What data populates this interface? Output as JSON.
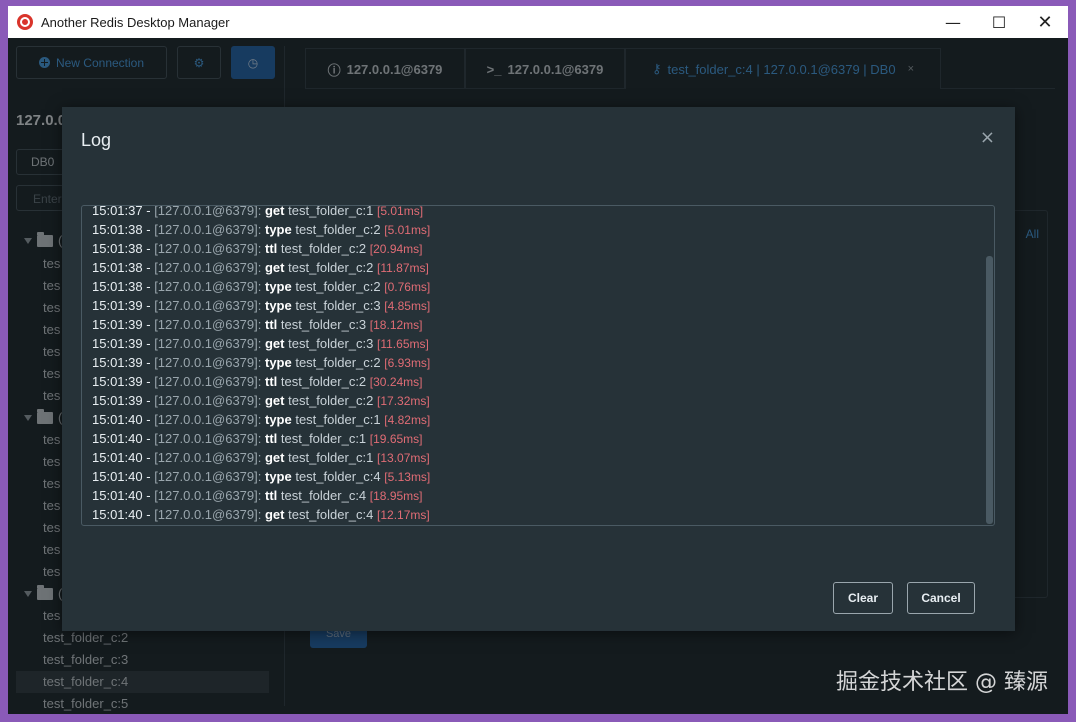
{
  "window": {
    "title": "Another Redis Desktop Manager"
  },
  "sidebar": {
    "new_connection_label": "New Connection",
    "server_name": "127.0.0",
    "db_value": "DB0",
    "filter_placeholder": "Enter",
    "keys": [
      "tes",
      "tes",
      "tes",
      "tes",
      "tes",
      "tes",
      "tes",
      "tes",
      "tes",
      "tes",
      "tes",
      "tes",
      "tes",
      "tes",
      "tes"
    ],
    "folder_paren": "(",
    "visible_keys": [
      "test_folder_c:2",
      "test_folder_c:3",
      "test_folder_c:4",
      "test_folder_c:5"
    ],
    "selected_key": "test_folder_c:4"
  },
  "tabs": [
    {
      "label": "127.0.0.1@6379",
      "icon": "info-icon"
    },
    {
      "label": "127.0.0.1@6379",
      "icon": "terminal-icon"
    },
    {
      "label": "test_folder_c:4 | 127.0.0.1@6379 | DB0",
      "icon": "key-icon",
      "close": "×"
    }
  ],
  "background": {
    "all_label": "All",
    "save_label": "Save"
  },
  "dialog": {
    "title": "Log",
    "close": "×",
    "clear_label": "Clear",
    "cancel_label": "Cancel",
    "log": [
      {
        "time": "15:01:37",
        "server": "[127.0.0.1@6379]:",
        "cmd": "get",
        "key": "test_folder_c:1",
        "dur": "[5.01ms]"
      },
      {
        "time": "15:01:38",
        "server": "[127.0.0.1@6379]:",
        "cmd": "type",
        "key": "test_folder_c:2",
        "dur": "[5.01ms]"
      },
      {
        "time": "15:01:38",
        "server": "[127.0.0.1@6379]:",
        "cmd": "ttl",
        "key": "test_folder_c:2",
        "dur": "[20.94ms]"
      },
      {
        "time": "15:01:38",
        "server": "[127.0.0.1@6379]:",
        "cmd": "get",
        "key": "test_folder_c:2",
        "dur": "[11.87ms]"
      },
      {
        "time": "15:01:38",
        "server": "[127.0.0.1@6379]:",
        "cmd": "type",
        "key": "test_folder_c:2",
        "dur": "[0.76ms]"
      },
      {
        "time": "15:01:39",
        "server": "[127.0.0.1@6379]:",
        "cmd": "type",
        "key": "test_folder_c:3",
        "dur": "[4.85ms]"
      },
      {
        "time": "15:01:39",
        "server": "[127.0.0.1@6379]:",
        "cmd": "ttl",
        "key": "test_folder_c:3",
        "dur": "[18.12ms]"
      },
      {
        "time": "15:01:39",
        "server": "[127.0.0.1@6379]:",
        "cmd": "get",
        "key": "test_folder_c:3",
        "dur": "[11.65ms]"
      },
      {
        "time": "15:01:39",
        "server": "[127.0.0.1@6379]:",
        "cmd": "type",
        "key": "test_folder_c:2",
        "dur": "[6.93ms]"
      },
      {
        "time": "15:01:39",
        "server": "[127.0.0.1@6379]:",
        "cmd": "ttl",
        "key": "test_folder_c:2",
        "dur": "[30.24ms]"
      },
      {
        "time": "15:01:39",
        "server": "[127.0.0.1@6379]:",
        "cmd": "get",
        "key": "test_folder_c:2",
        "dur": "[17.32ms]"
      },
      {
        "time": "15:01:40",
        "server": "[127.0.0.1@6379]:",
        "cmd": "type",
        "key": "test_folder_c:1",
        "dur": "[4.82ms]"
      },
      {
        "time": "15:01:40",
        "server": "[127.0.0.1@6379]:",
        "cmd": "ttl",
        "key": "test_folder_c:1",
        "dur": "[19.65ms]"
      },
      {
        "time": "15:01:40",
        "server": "[127.0.0.1@6379]:",
        "cmd": "get",
        "key": "test_folder_c:1",
        "dur": "[13.07ms]"
      },
      {
        "time": "15:01:40",
        "server": "[127.0.0.1@6379]:",
        "cmd": "type",
        "key": "test_folder_c:4",
        "dur": "[5.13ms]"
      },
      {
        "time": "15:01:40",
        "server": "[127.0.0.1@6379]:",
        "cmd": "ttl",
        "key": "test_folder_c:4",
        "dur": "[18.95ms]"
      },
      {
        "time": "15:01:40",
        "server": "[127.0.0.1@6379]:",
        "cmd": "get",
        "key": "test_folder_c:4",
        "dur": "[12.17ms]"
      }
    ]
  },
  "watermark": "掘金技术社区 @ 臻源"
}
